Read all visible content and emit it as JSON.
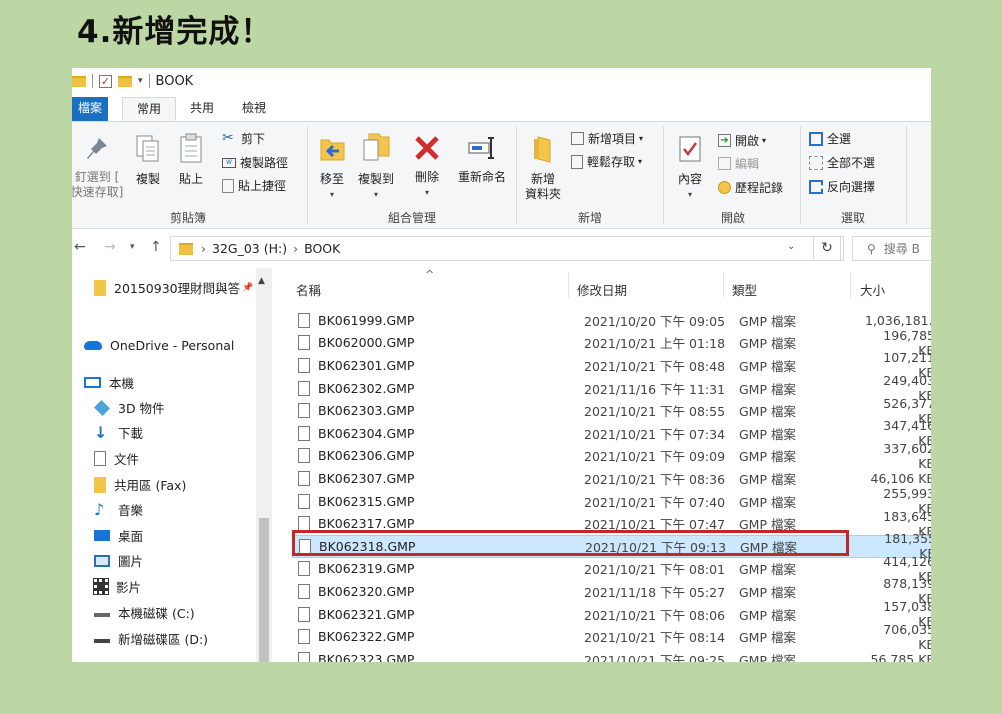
{
  "caption": "4.新增完成！",
  "window": {
    "title": "BOOK"
  },
  "tabs": {
    "file": "檔案",
    "home": "常用",
    "share": "共用",
    "view": "檢視"
  },
  "ribbon": {
    "clipboard": {
      "label": "剪貼簿",
      "pin": "釘選到 [\n快速存取]",
      "copy": "複製",
      "paste": "貼上",
      "cut": "剪下",
      "copy_path": "複製路徑",
      "paste_shortcut": "貼上捷徑"
    },
    "organize": {
      "label": "組合管理",
      "move_to": "移至",
      "copy_to": "複製到",
      "delete": "刪除",
      "rename": "重新命名"
    },
    "new": {
      "label": "新增",
      "new_folder": "新增\n資料夾",
      "new_item": "新增項目",
      "easy_access": "輕鬆存取"
    },
    "open": {
      "label": "開啟",
      "properties": "內容",
      "open": "開啟",
      "edit": "編輯",
      "history": "歷程記錄"
    },
    "select": {
      "label": "選取",
      "select_all": "全選",
      "select_none": "全部不選",
      "invert": "反向選擇"
    }
  },
  "address": {
    "drive": "32G_03 (H:)",
    "folder": "BOOK",
    "search_placeholder": "搜尋 B"
  },
  "nav": {
    "pinned": "20150930理財問與答",
    "onedrive": "OneDrive - Personal",
    "thispc": "本機",
    "objects3d": "3D 物件",
    "downloads": "下載",
    "documents": "文件",
    "shared": "共用區 (Fax)",
    "music": "音樂",
    "desktop": "桌面",
    "pictures": "圖片",
    "videos": "影片",
    "disk_c": "本機磁碟 (C:)",
    "disk_d": "新增磁碟區 (D:)"
  },
  "columns": {
    "name": "名稱",
    "date": "修改日期",
    "type": "類型",
    "size": "大小"
  },
  "files": [
    {
      "name": "BK061999.GMP",
      "date": "2021/10/20 下午 09:05",
      "type": "GMP 檔案",
      "size": "1,036,181..."
    },
    {
      "name": "BK062000.GMP",
      "date": "2021/10/21 上午 01:18",
      "type": "GMP 檔案",
      "size": "196,785 KB"
    },
    {
      "name": "BK062301.GMP",
      "date": "2021/10/21 下午 08:48",
      "type": "GMP 檔案",
      "size": "107,211 KB"
    },
    {
      "name": "BK062302.GMP",
      "date": "2021/11/16 下午 11:31",
      "type": "GMP 檔案",
      "size": "249,403 KB"
    },
    {
      "name": "BK062303.GMP",
      "date": "2021/10/21 下午 08:55",
      "type": "GMP 檔案",
      "size": "526,377 KB"
    },
    {
      "name": "BK062304.GMP",
      "date": "2021/10/21 下午 07:34",
      "type": "GMP 檔案",
      "size": "347,416 KB"
    },
    {
      "name": "BK062306.GMP",
      "date": "2021/10/21 下午 09:09",
      "type": "GMP 檔案",
      "size": "337,602 KB"
    },
    {
      "name": "BK062307.GMP",
      "date": "2021/10/21 下午 08:36",
      "type": "GMP 檔案",
      "size": "46,106 KB"
    },
    {
      "name": "BK062315.GMP",
      "date": "2021/10/21 下午 07:40",
      "type": "GMP 檔案",
      "size": "255,993 KB"
    },
    {
      "name": "BK062317.GMP",
      "date": "2021/10/21 下午 07:47",
      "type": "GMP 檔案",
      "size": "183,645 KB"
    },
    {
      "name": "BK062318.GMP",
      "date": "2021/10/21 下午 09:13",
      "type": "GMP 檔案",
      "size": "181,355 KB",
      "selected": true
    },
    {
      "name": "BK062319.GMP",
      "date": "2021/10/21 下午 08:01",
      "type": "GMP 檔案",
      "size": "414,126 KB"
    },
    {
      "name": "BK062320.GMP",
      "date": "2021/11/18 下午 05:27",
      "type": "GMP 檔案",
      "size": "878,139 KB"
    },
    {
      "name": "BK062321.GMP",
      "date": "2021/10/21 下午 08:06",
      "type": "GMP 檔案",
      "size": "157,038 KB"
    },
    {
      "name": "BK062322.GMP",
      "date": "2021/10/21 下午 08:14",
      "type": "GMP 檔案",
      "size": "706,035 KB"
    },
    {
      "name": "BK062323.GMP",
      "date": "2021/10/21 下午 09:25",
      "type": "GMP 檔案",
      "size": "56,785 KB"
    }
  ],
  "colors": {
    "accent": "#1a6fc1",
    "highlight": "#c0282c",
    "selection": "#cce8ff",
    "background": "#bdd7a4"
  }
}
